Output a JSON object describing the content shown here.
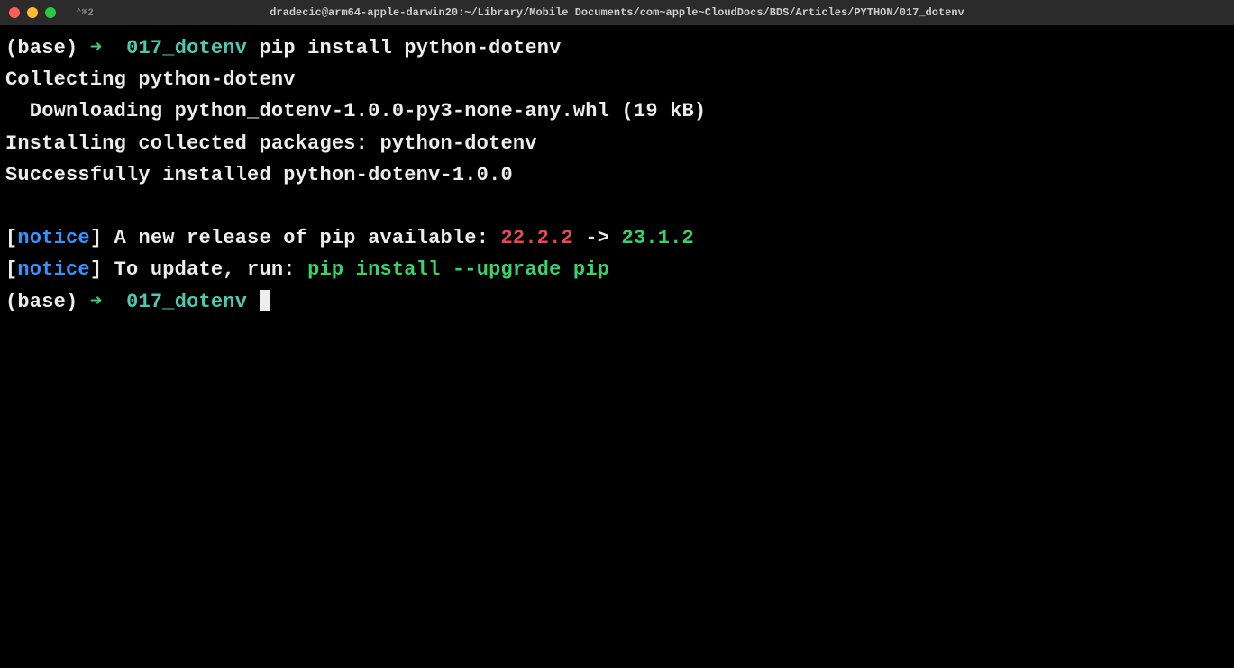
{
  "titlebar": {
    "shell_indicator": "⌃⌘2",
    "title": "dradecic@arm64-apple-darwin20:~/Library/Mobile Documents/com~apple~CloudDocs/BDS/Articles/PYTHON/017_dotenv"
  },
  "prompt1": {
    "base": "(base)",
    "arrow": "➜",
    "dir": "017_dotenv",
    "command": "pip install python-dotenv"
  },
  "output": {
    "line1": "Collecting python-dotenv",
    "line2": "  Downloading python_dotenv-1.0.0-py3-none-any.whl (19 kB)",
    "line3": "Installing collected packages: python-dotenv",
    "line4": "Successfully installed python-dotenv-1.0.0"
  },
  "notice1": {
    "bracket_open": "[",
    "label": "notice",
    "bracket_close": "]",
    "text": " A new release of pip available: ",
    "old_version": "22.2.2",
    "arrow": " -> ",
    "new_version": "23.1.2"
  },
  "notice2": {
    "bracket_open": "[",
    "label": "notice",
    "bracket_close": "]",
    "text": " To update, run: ",
    "command": "pip install --upgrade pip"
  },
  "prompt2": {
    "base": "(base)",
    "arrow": "➜",
    "dir": "017_dotenv"
  }
}
